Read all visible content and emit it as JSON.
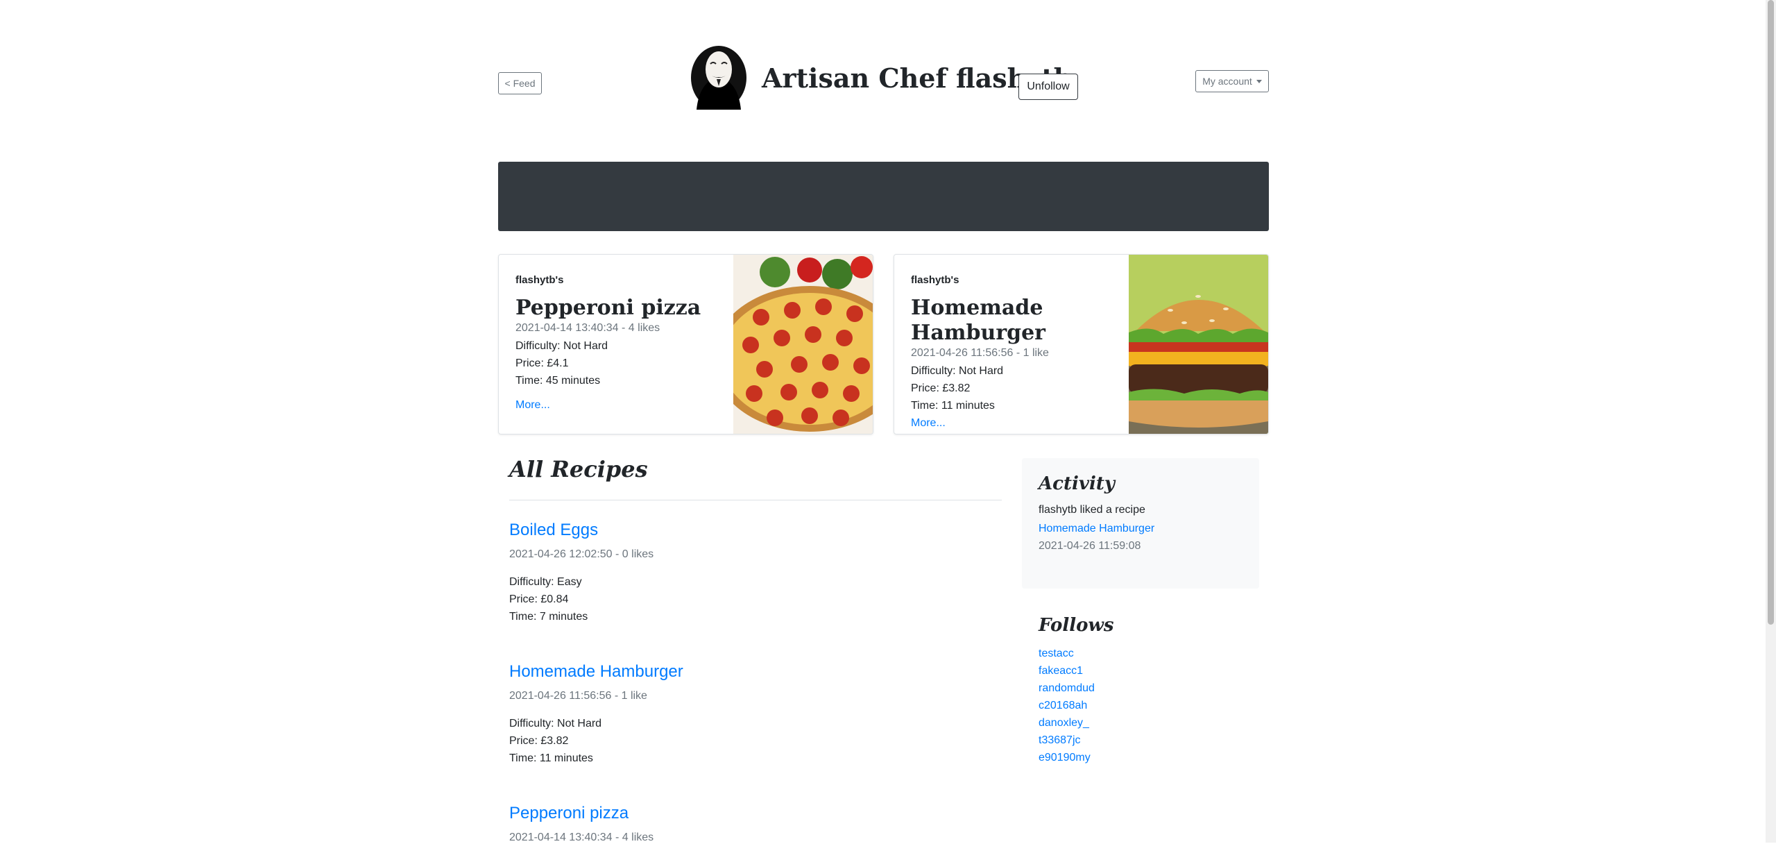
{
  "header": {
    "feed_button": "< Feed",
    "title": "Artisan Chef flashytb",
    "unfollow_button": "Unfollow",
    "account_button": "My account"
  },
  "featured": [
    {
      "owner": "flashytb's",
      "title": "Pepperoni pizza",
      "meta": "2021-04-14 13:40:34 - 4 likes",
      "difficulty": "Difficulty: Not Hard",
      "price": "Price: £4.1",
      "time": "Time: 45 minutes",
      "more": "More..."
    },
    {
      "owner": "flashytb's",
      "title": "Homemade Hamburger",
      "meta": "2021-04-26 11:56:56 - 1 like",
      "difficulty": "Difficulty: Not Hard",
      "price": "Price: £3.82",
      "time": "Time: 11 minutes",
      "more": "More..."
    }
  ],
  "recipes": {
    "heading": "All Recipes",
    "items": [
      {
        "title": "Boiled Eggs",
        "meta": "2021-04-26 12:02:50 - 0 likes",
        "difficulty": "Difficulty: Easy",
        "price": "Price: £0.84",
        "time": "Time: 7 minutes"
      },
      {
        "title": "Homemade Hamburger",
        "meta": "2021-04-26 11:56:56 - 1 like",
        "difficulty": "Difficulty: Not Hard",
        "price": "Price: £3.82",
        "time": "Time: 11 minutes"
      },
      {
        "title": "Pepperoni pizza",
        "meta": "2021-04-14 13:40:34 - 4 likes"
      }
    ]
  },
  "activity": {
    "heading": "Activity",
    "text": "flashytb liked a recipe",
    "link": "Homemade Hamburger",
    "time": "2021-04-26 11:59:08"
  },
  "follows": {
    "heading": "Follows",
    "users": [
      "testacc",
      "fakeacc1",
      "randomdud",
      "c20168ah",
      "danoxley_",
      "t33687jc",
      "e90190my"
    ]
  },
  "colors": {
    "link": "#007bff",
    "banner": "#343a40",
    "muted": "#6c757d",
    "sidebar_bg": "#f8f9fa"
  }
}
